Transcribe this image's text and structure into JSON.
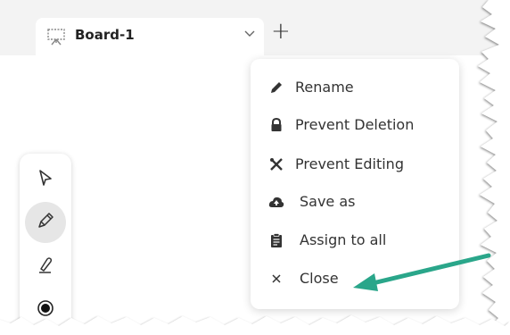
{
  "tab": {
    "title": "Board-1",
    "icon": "whiteboard-icon",
    "dropdown_icon": "chevron-down-icon",
    "add_label": "+"
  },
  "toolbar": {
    "tools": [
      {
        "name": "select-tool",
        "icon": "cursor-arrow-icon",
        "active": false
      },
      {
        "name": "pencil-tool",
        "icon": "pencil-icon",
        "active": true
      },
      {
        "name": "highlighter-tool",
        "icon": "highlighter-icon",
        "active": false
      },
      {
        "name": "color-tool",
        "icon": "color-dot-icon",
        "active": false
      }
    ]
  },
  "menu": {
    "items": [
      {
        "label": "Rename",
        "icon": "pencil-icon"
      },
      {
        "label": "Prevent Deletion",
        "icon": "lock-icon"
      },
      {
        "label": "Prevent Editing",
        "icon": "crossed-tools-icon"
      },
      {
        "label": "Save as",
        "icon": "cloud-upload-icon"
      },
      {
        "label": "Assign to all",
        "icon": "clipboard-icon"
      },
      {
        "label": "Close",
        "icon": "close-icon"
      }
    ]
  },
  "colors": {
    "arrow": "#2aa68a",
    "tab_strip": "#f3f3f3",
    "text": "#333333"
  }
}
